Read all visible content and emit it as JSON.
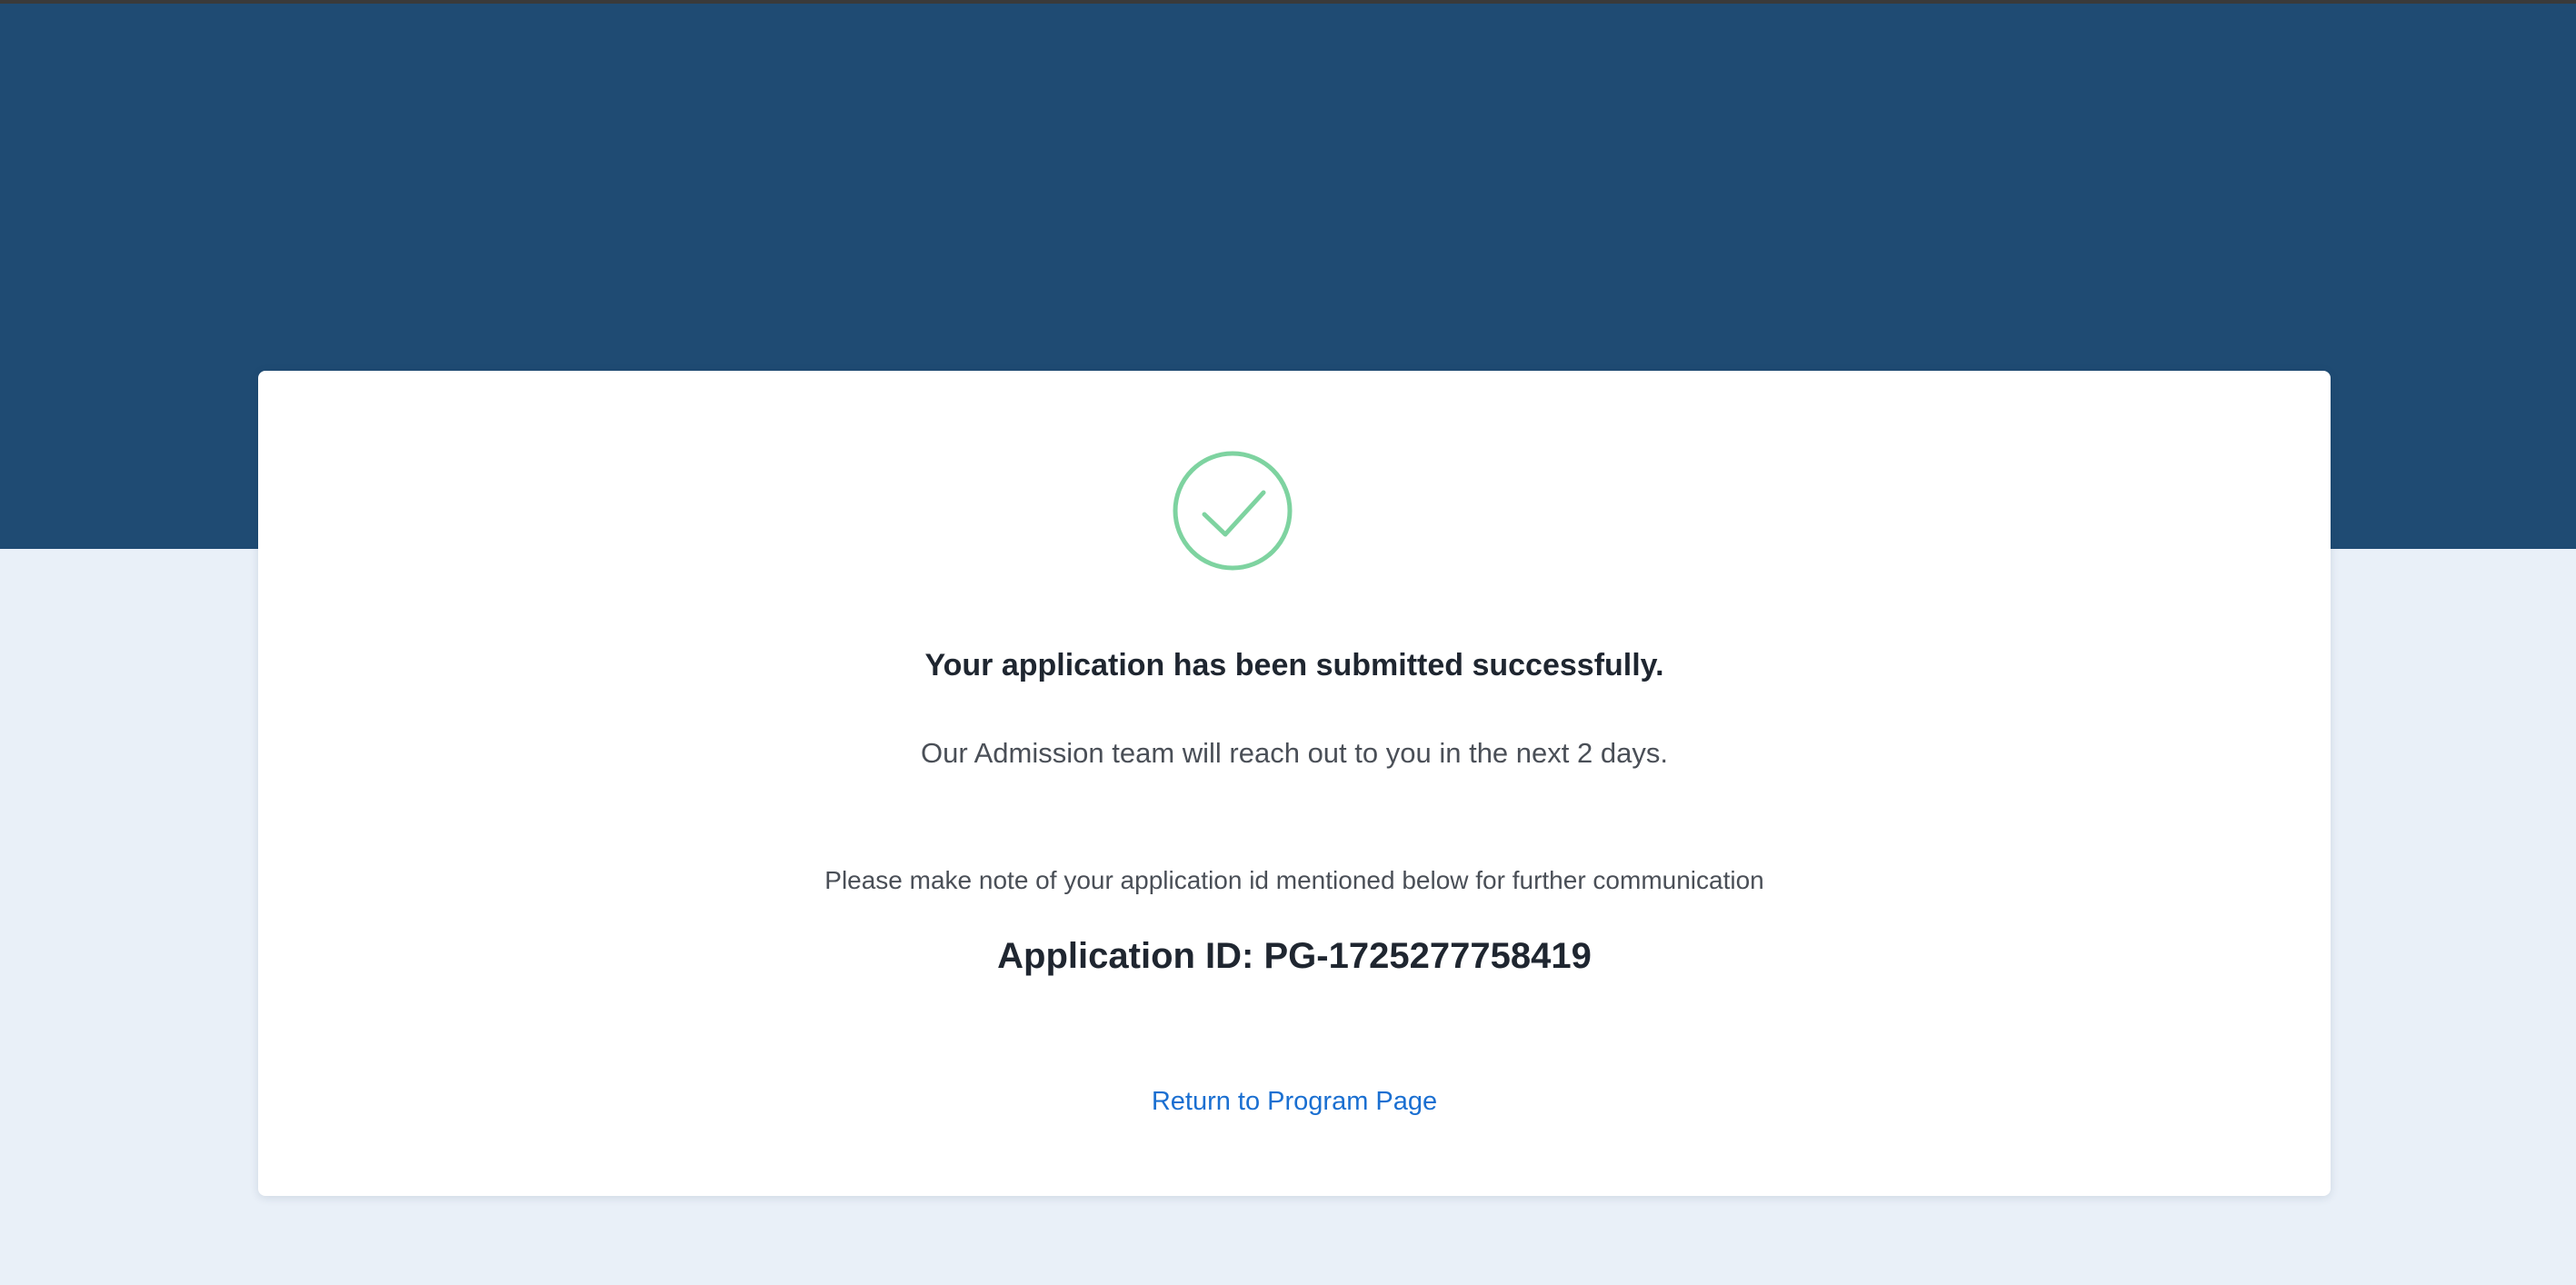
{
  "colors": {
    "header_band": "#1f4b73",
    "page_background": "#e9f0f8",
    "card_background": "#ffffff",
    "success_green": "#7ed3a0",
    "link_blue": "#1a6fd1",
    "heading_text": "#1f2630",
    "body_text": "#4a4f57"
  },
  "success": {
    "icon": "check-circle-icon",
    "headline": "Your application has been submitted successfully.",
    "subtext": "Our Admission team will reach out to you in the next 2 days.",
    "note": "Please make note of your application id mentioned below for further communication",
    "application_id_label": "Application ID: ",
    "application_id_value": "PG-1725277758419",
    "return_link_label": "Return to Program Page"
  }
}
